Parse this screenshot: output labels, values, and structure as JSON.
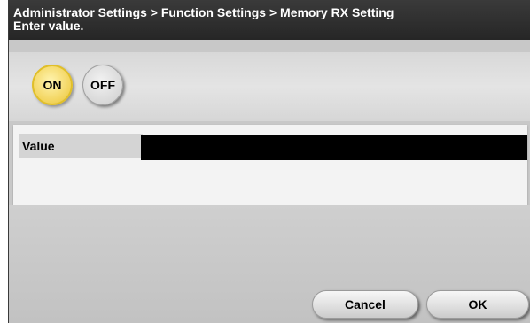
{
  "header": {
    "breadcrumb": "Administrator Settings > Function Settings > Memory RX Setting",
    "instruction": "Enter value."
  },
  "toggle": {
    "on_label": "ON",
    "off_label": "OFF",
    "selected": "ON"
  },
  "value_field": {
    "label": "Value",
    "value": ""
  },
  "buttons": {
    "cancel_label": "Cancel",
    "ok_label": "OK"
  },
  "colors": {
    "header_bg": "#2f2f2f",
    "selected_toggle": "#f2d35a",
    "value_field_bg": "#000000"
  }
}
